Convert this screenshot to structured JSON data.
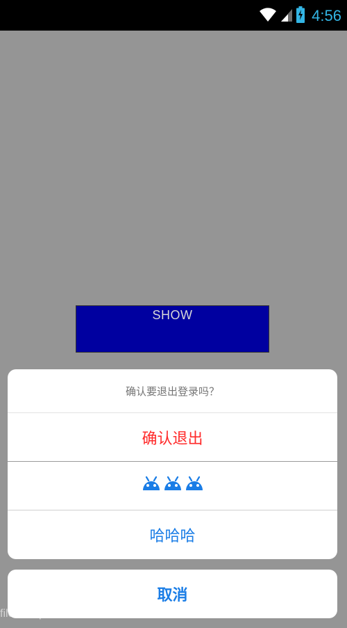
{
  "status_bar": {
    "time": "4:56",
    "icons": [
      "wifi-icon",
      "cell-signal-icon",
      "battery-charging-icon"
    ]
  },
  "show_button": {
    "label": "SHOW",
    "color": "#0000a0"
  },
  "action_sheet": {
    "title": "确认要退出登录吗？",
    "options": [
      {
        "label": "确认退出",
        "color": "#ff2a2a"
      },
      {
        "icons": [
          "android-icon",
          "android-icon",
          "android-icon"
        ],
        "color": "#1a7de6"
      },
      {
        "label": "哈哈哈",
        "color": "#1a7de6"
      }
    ],
    "cancel_label": "取消"
  },
  "watermark": "files for personal use",
  "colors": {
    "overlay": "#959595",
    "accent": "#1a7de6",
    "status_time": "#33b5e5"
  }
}
